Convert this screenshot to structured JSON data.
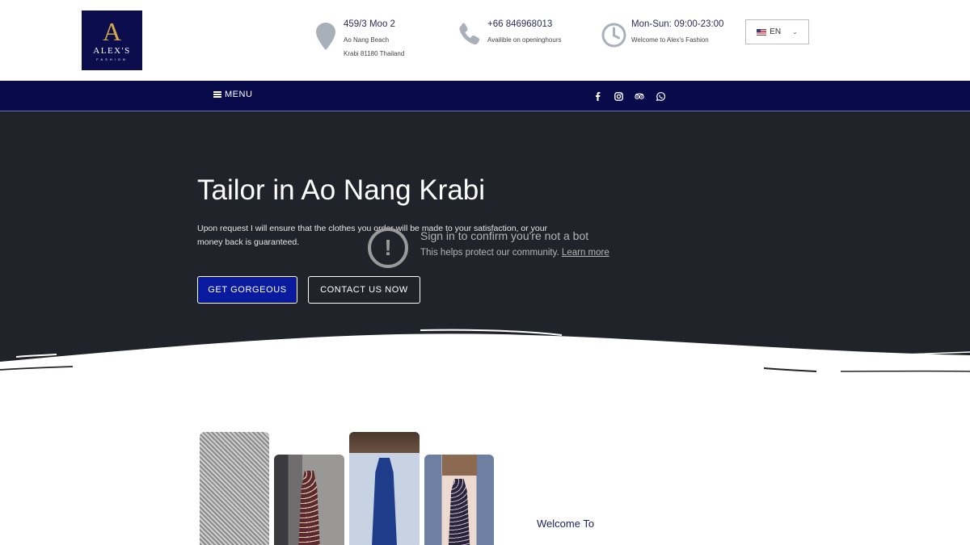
{
  "brand": {
    "mark": "A",
    "name": "ALEX'S",
    "sub": "FASHION"
  },
  "header": {
    "address": {
      "title": "459/3 Moo 2",
      "line1": "Ao Nang Beach",
      "line2": "Krabi 81180 Thailand",
      "icon": "map-pin-icon"
    },
    "phone": {
      "title": "+66 846968013",
      "line1": "Availible on openinghours",
      "icon": "phone-icon"
    },
    "hours": {
      "title": "Mon-Sun: 09:00-23:00",
      "line1": "Welcome to Alex's Fashion",
      "icon": "clock-icon"
    },
    "language": {
      "value": "EN",
      "flag": "us-flag-icon"
    }
  },
  "nav": {
    "menu_label": "MENU",
    "socials": [
      "facebook-icon",
      "instagram-icon",
      "tripadvisor-icon",
      "whatsapp-icon"
    ],
    "background": "#080a4a"
  },
  "hero": {
    "title": "Tailor in Ao Nang Krabi",
    "text": "Upon request I will ensure that the clothes you order will be made to your satisfaction, or your money back is guaranteed.",
    "primary_button": "GET GORGEOUS",
    "secondary_button": "CONTACT US NOW",
    "background": "#21232b",
    "primary_color": "#0a1a9e"
  },
  "bot_notice": {
    "title": "Sign in to confirm you're not a bot",
    "text": "This helps protect our community.",
    "link": "Learn more"
  },
  "section": {
    "welcome": "Welcome To"
  }
}
